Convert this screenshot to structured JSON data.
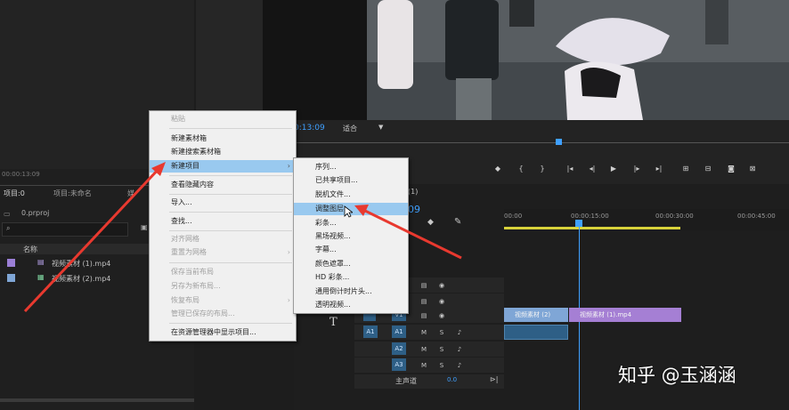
{
  "monitor": {
    "timecode": "0:13:09",
    "fit": "适合"
  },
  "project": {
    "timecode": "00:00:13:09",
    "tab_project": "项目:0",
    "tab_project2": "项目:未命名",
    "tab_more": "媒",
    "proj_file": "0.prproj",
    "col_name": "名称",
    "items": [
      {
        "name": "视频素材 (1).mp4",
        "color": "#9b7fd6"
      },
      {
        "name": "视频素材 (2).mp4",
        "color": "#7fa6d6"
      }
    ]
  },
  "context_menu": {
    "paste": "粘贴",
    "new_bin": "新建素材箱",
    "new_search_bin": "新建搜索素材箱",
    "new_item": "新建项目",
    "view_hidden": "查看隐藏内容",
    "import": "导入...",
    "find": "查找...",
    "align_grid": "对齐网格",
    "reset_grid": "重置为网格",
    "save_layout": "保存当前布局",
    "save_as_layout": "另存为新布局...",
    "restore_layout": "恢复布局",
    "manage_layouts": "管理已保存的布局...",
    "show_in_explorer": "在资源管理器中显示项目..."
  },
  "submenu": {
    "sequence": "序列...",
    "shared_project": "已共享项目...",
    "offline_file": "脱机文件...",
    "adjustment_layer": "调整图层",
    "bars": "彩条...",
    "black_video": "黑场视频...",
    "captions": "字幕...",
    "color_matte": "颜色遮罩...",
    "hd_bars": "HD 彩条...",
    "countdown": "通用倒计时片头...",
    "transparent_video": "透明视频..."
  },
  "timeline": {
    "tab": "(1)",
    "timecode": "09",
    "ruler": [
      "00:00",
      "00:00:15:00",
      "00:00:30:00",
      "00:00:45:00"
    ],
    "tracks_video": [
      "V3",
      "V2",
      "V1"
    ],
    "tracks_audio": [
      "A1",
      "A2",
      "A3"
    ],
    "master": "主声道",
    "master_value": "0.0",
    "clip_v1a": "视频素材 (2)",
    "clip_v1b": "视频素材 (1).mp4"
  },
  "watermark": "知乎 @玉涵涵",
  "colors": {
    "selection": "#99c9ef",
    "clip_purple": "#a57fd4",
    "clip_blue": "#7fa6d6",
    "timecode_blue": "#3fa0ff",
    "arrow_red": "#e8392f"
  }
}
